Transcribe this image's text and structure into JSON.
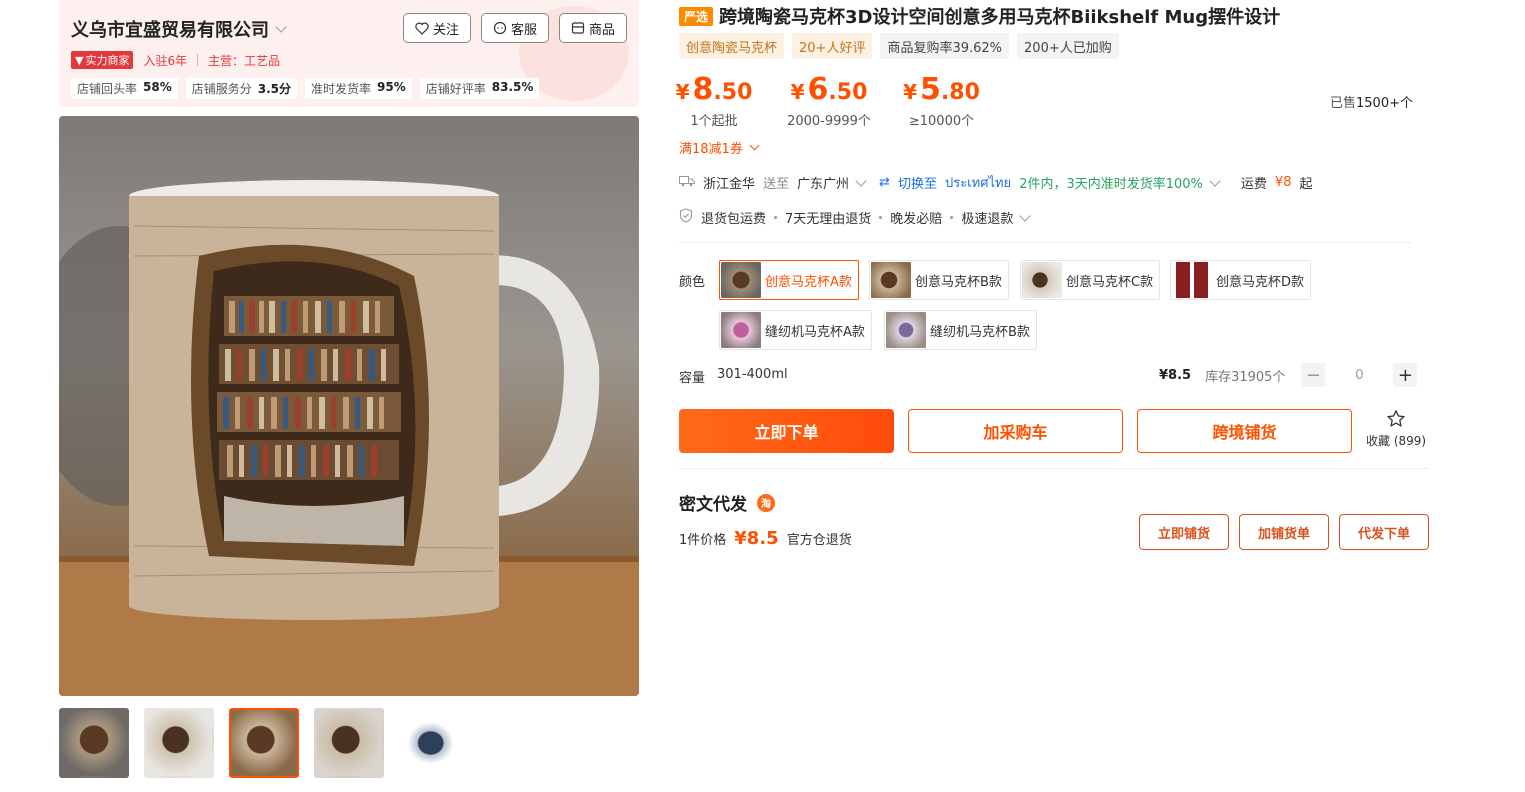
{
  "shop": {
    "name": "义乌市宜盛贸易有限公司",
    "buttons": {
      "follow": "关注",
      "service": "客服",
      "goods": "商品"
    },
    "badge": "实力商家",
    "years": "入驻6年",
    "main_business": "主营：工艺品",
    "stats": [
      {
        "label": "店铺回头率",
        "value": "58%"
      },
      {
        "label": "店铺服务分",
        "value": "3.5分"
      },
      {
        "label": "准时发货率",
        "value": "95%"
      },
      {
        "label": "店铺好评率",
        "value": "83.5%"
      }
    ]
  },
  "product": {
    "badge": "严选",
    "title": "跨境陶瓷马克杯3D设计空间创意多用马克杯Biikshelf Mug摆件设计",
    "tags": [
      "创意陶瓷马克杯",
      "20+人好评",
      "商品复购率39.62%",
      "200+人已加购"
    ],
    "prices": [
      {
        "currency": "¥",
        "int": "8",
        "dec": ".50",
        "range": "1个起批"
      },
      {
        "currency": "¥",
        "int": "6",
        "dec": ".50",
        "range": "2000-9999个"
      },
      {
        "currency": "¥",
        "int": "5",
        "dec": ".80",
        "range": "≥10000个"
      }
    ],
    "sold_prefix": "已售",
    "sold_count": "1500+个",
    "coupon": "满18减1券",
    "shipping": {
      "from": "浙江金华",
      "to_label": "送至",
      "to": "广东广州",
      "switch_label": "切换至",
      "switch_target": "ประเทศไทย",
      "delivery": "2件内，3天内准时发货率100%",
      "fee_label": "运费",
      "fee": "¥8",
      "fee_suffix": "起"
    },
    "services": [
      "退货包运费",
      "7天无理由退货",
      "晚发必赔",
      "极速退款"
    ],
    "color_label": "颜色",
    "skus": [
      {
        "label": "创意马克杯A款",
        "selected": true
      },
      {
        "label": "创意马克杯B款",
        "selected": false
      },
      {
        "label": "创意马克杯C款",
        "selected": false
      },
      {
        "label": "创意马克杯D款",
        "selected": false
      },
      {
        "label": "缝纫机马克杯A款",
        "selected": false
      },
      {
        "label": "缝纫机马克杯B款",
        "selected": false
      }
    ],
    "capacity_label": "容量",
    "capacity_value": "301-400ml",
    "unit_price": "¥8.5",
    "stock": "库存31905个",
    "quantity": "0",
    "qty_minus": "−",
    "qty_plus": "+",
    "actions": {
      "buy": "立即下单",
      "cart": "加采购车",
      "crossborder": "跨境铺货"
    },
    "favorite": "收藏 (899)"
  },
  "dropship": {
    "title": "密文代发",
    "icon_text": "淘",
    "price_label": "1件价格",
    "price": "¥8.5",
    "note": "官方仓退货",
    "buttons": {
      "list": "立即铺货",
      "add": "加铺货单",
      "order": "代发下单"
    }
  },
  "colors": {
    "accent": "#ff5000",
    "blue": "#1a6fe8",
    "green": "#27a35d"
  }
}
